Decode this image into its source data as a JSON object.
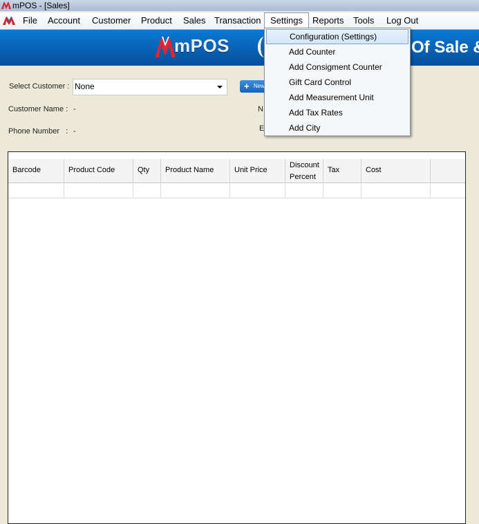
{
  "window": {
    "title": "mPOS - [Sales]"
  },
  "menu": {
    "items": [
      "File",
      "Account",
      "Customer",
      "Product",
      "Sales",
      "Transaction",
      "Settings",
      "Reports",
      "Tools",
      "Log Out"
    ],
    "active": "Settings"
  },
  "banner": {
    "brand": "mPOS",
    "slogan": "Of Sale &"
  },
  "form": {
    "select_customer_label": "Select Customer :",
    "customer_select_value": "None",
    "new_button_label": "New",
    "customer_name_label": "Customer Name :",
    "customer_name_value": "-",
    "phone_number_label": "Phone Number   :",
    "phone_number_value": "-",
    "nrc_label_partial": "NI",
    "email_label_partial": "E"
  },
  "grid": {
    "columns": [
      "Barcode",
      "Product Code",
      "Qty",
      "Product Name",
      "Unit Price",
      "Discount\nPercent",
      "Tax",
      "Cost"
    ]
  },
  "settings_dropdown": {
    "items": [
      "Configuration (Settings)",
      "Add Counter",
      "Add Consigment Counter",
      "Gift Card Control",
      "Add Measurement Unit",
      "Add Tax Rates",
      "Add City"
    ],
    "highlighted": "Configuration (Settings)"
  },
  "colors": {
    "banner": "#0b6fc8",
    "highlight": "#d3e6fa",
    "background": "#ece9d8"
  }
}
